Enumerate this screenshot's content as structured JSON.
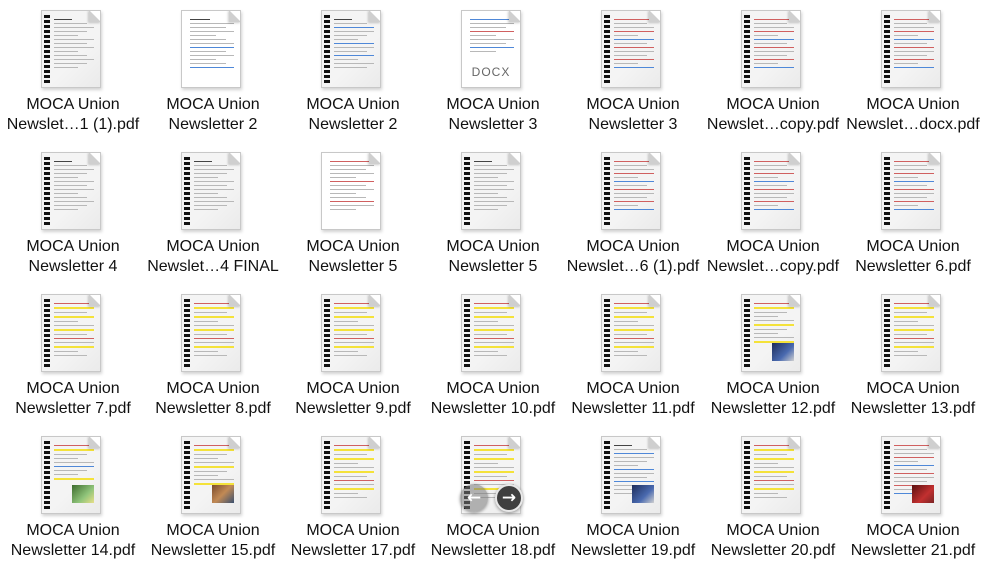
{
  "files": [
    {
      "line1": "MOCA Union",
      "line2": "Newslet…1 (1).pdf",
      "type": "pdf",
      "variant": "gray"
    },
    {
      "line1": "MOCA Union",
      "line2": "Newsletter 2",
      "type": "doc",
      "variant": "plain"
    },
    {
      "line1": "MOCA Union",
      "line2": "Newsletter 2",
      "type": "pdf",
      "variant": "blue"
    },
    {
      "line1": "MOCA Union",
      "line2": "Newsletter 3",
      "type": "docx",
      "variant": "docx",
      "ext": "DOCX"
    },
    {
      "line1": "MOCA Union",
      "line2": "Newsletter 3",
      "type": "pdf",
      "variant": "red"
    },
    {
      "line1": "MOCA Union",
      "line2": "Newslet…copy.pdf",
      "type": "pdf",
      "variant": "red"
    },
    {
      "line1": "MOCA Union",
      "line2": "Newslet…docx.pdf",
      "type": "pdf",
      "variant": "red"
    },
    {
      "line1": "MOCA Union",
      "line2": "Newsletter 4",
      "type": "pdf",
      "variant": "gray"
    },
    {
      "line1": "MOCA Union",
      "line2": "Newslet…4 FINAL",
      "type": "pdf",
      "variant": "gray"
    },
    {
      "line1": "MOCA Union",
      "line2": "Newsletter 5",
      "type": "doc",
      "variant": "plainred"
    },
    {
      "line1": "MOCA Union",
      "line2": "Newsletter 5",
      "type": "pdf",
      "variant": "gray"
    },
    {
      "line1": "MOCA Union",
      "line2": "Newslet…6 (1).pdf",
      "type": "pdf",
      "variant": "red"
    },
    {
      "line1": "MOCA Union",
      "line2": "Newslet…copy.pdf",
      "type": "pdf",
      "variant": "red"
    },
    {
      "line1": "MOCA Union",
      "line2": "Newsletter 6.pdf",
      "type": "pdf",
      "variant": "red"
    },
    {
      "line1": "MOCA Union",
      "line2": "Newsletter 7.pdf",
      "type": "pdf",
      "variant": "yellow"
    },
    {
      "line1": "MOCA Union",
      "line2": "Newsletter 8.pdf",
      "type": "pdf",
      "variant": "yellow"
    },
    {
      "line1": "MOCA Union",
      "line2": "Newsletter 9.pdf",
      "type": "pdf",
      "variant": "yellow"
    },
    {
      "line1": "MOCA Union",
      "line2": "Newsletter 10.pdf",
      "type": "pdf",
      "variant": "yellow"
    },
    {
      "line1": "MOCA Union",
      "line2": "Newsletter 11.pdf",
      "type": "pdf",
      "variant": "yellow"
    },
    {
      "line1": "MOCA Union",
      "line2": "Newsletter 12.pdf",
      "type": "pdf",
      "variant": "photo"
    },
    {
      "line1": "MOCA Union",
      "line2": "Newsletter 13.pdf",
      "type": "pdf",
      "variant": "yellow"
    },
    {
      "line1": "MOCA Union",
      "line2": "Newsletter 14.pdf",
      "type": "pdf",
      "variant": "green"
    },
    {
      "line1": "MOCA Union",
      "line2": "Newsletter 15.pdf",
      "type": "pdf",
      "variant": "photo"
    },
    {
      "line1": "MOCA Union",
      "line2": "Newsletter 17.pdf",
      "type": "pdf",
      "variant": "yellow"
    },
    {
      "line1": "MOCA Union",
      "line2": "Newsletter 18.pdf",
      "type": "pdf",
      "variant": "yellow"
    },
    {
      "line1": "MOCA Union",
      "line2": "Newsletter 19.pdf",
      "type": "pdf",
      "variant": "blue"
    },
    {
      "line1": "MOCA Union",
      "line2": "Newsletter 20.pdf",
      "type": "pdf",
      "variant": "yellow"
    },
    {
      "line1": "MOCA Union",
      "line2": "Newsletter 21.pdf",
      "type": "pdf",
      "variant": "red"
    }
  ],
  "nav": {
    "prev_icon": "←",
    "next_icon": "→"
  },
  "colors": {
    "text": "#111111",
    "highlight": "#f4e23a",
    "link": "#4f88d8",
    "accent_red": "#d06060"
  }
}
